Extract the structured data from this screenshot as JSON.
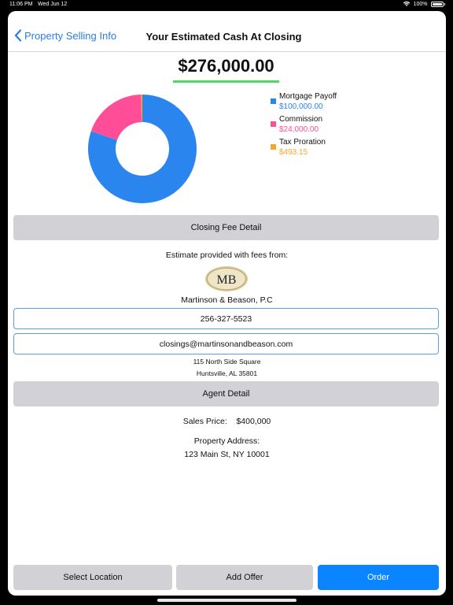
{
  "status_bar": {
    "time": "11:06 PM",
    "date": "Wed Jun 12",
    "battery": "100%"
  },
  "nav": {
    "back_label": "Property Selling Info",
    "title": "Your Estimated Cash At Closing"
  },
  "summary": {
    "total": "$276,000.00"
  },
  "chart_data": {
    "type": "pie",
    "title": "",
    "categories": [
      "Mortgage Payoff",
      "Commission",
      "Tax Proration"
    ],
    "values": [
      100000.0,
      24000.0,
      493.15
    ],
    "colors": [
      "#2a86ee",
      "#ff4d97",
      "#f6a72b"
    ],
    "donut": true,
    "legend": "right"
  },
  "legend": {
    "items": [
      {
        "label": "Mortgage Payoff",
        "value": "$100,000.00",
        "color": "#2a86ee"
      },
      {
        "label": "Commission",
        "value": "$24,000.00",
        "color": "#ff4d97"
      },
      {
        "label": "Tax Proration",
        "value": "$493.15",
        "color": "#f6a72b"
      }
    ]
  },
  "closing_fee": {
    "button_label": "Closing Fee Detail"
  },
  "estimate": {
    "intro": "Estimate provided with fees from:",
    "logo_text": "MB",
    "company": "Martinson & Beason, P.C",
    "phone": "256-327-5523",
    "email": "closings@martinsonandbeason.com",
    "address_line1": "115 North Side Square",
    "address_line2": "Huntsville, AL 35801"
  },
  "agent": {
    "button_label": "Agent Detail",
    "sales_price_label": "Sales Price:",
    "sales_price_value": "$400,000",
    "property_address_label": "Property Address:",
    "property_address_value": "123 Main St, NY 10001"
  },
  "actions": {
    "select_location": "Select Location",
    "add_offer": "Add Offer",
    "order": "Order"
  }
}
